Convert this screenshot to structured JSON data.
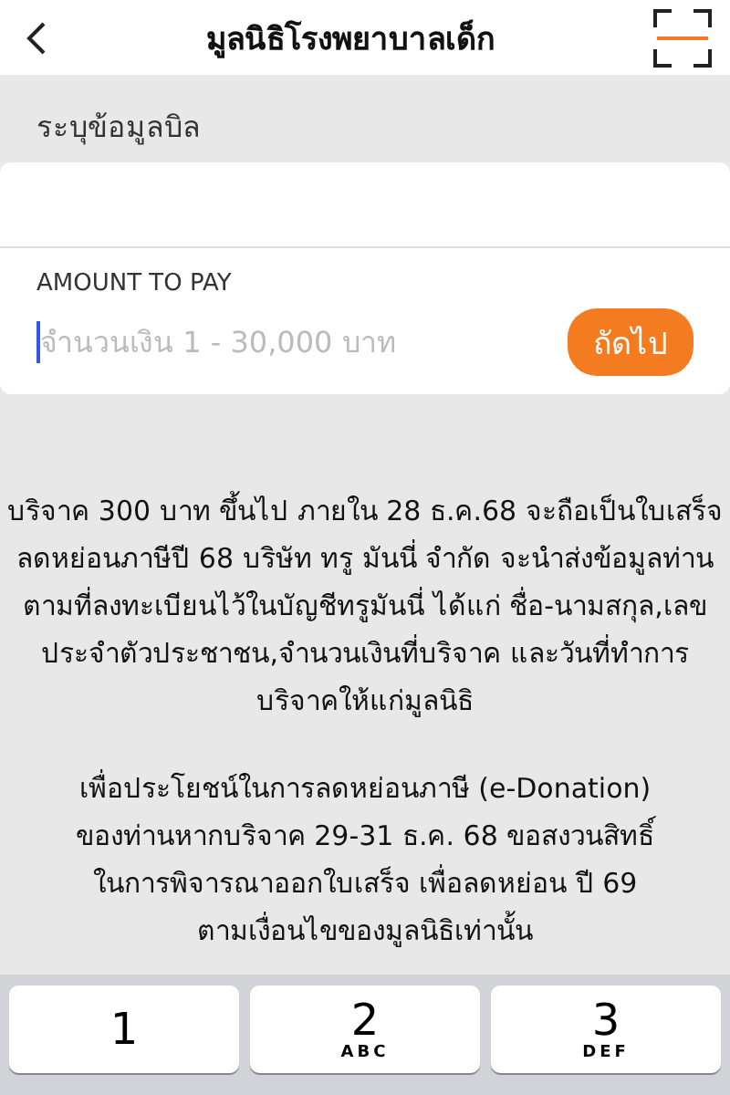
{
  "header": {
    "title": "มูลนิธิโรงพยาบาลเด็ก"
  },
  "section_label": "ระบุข้อมูลบิล",
  "amount": {
    "label": "AMOUNT TO PAY",
    "placeholder": "จำนวนเงิน 1 - 30,000 บาท",
    "button": "ถัดไป"
  },
  "notice": [
    {
      "lines": [
        "บริจาค 300 บาท ขึ้นไป ภายใน 28 ธ.ค.68 จะถือเป็นใบเสร็จ",
        "ลดหย่อนภาษีปี 68 บริษัท ทรู มันนี่ จำกัด จะนำส่งข้อมูลท่าน",
        "ตามที่ลงทะเบียนไว้ในบัญชีทรูมันนี่ ได้แก่ ชื่อ-นามสกุล,เลข",
        "ประจำตัวประชาชน,จำนวนเงินที่บริจาค และวันที่ทำการ",
        "บริจาคให้แก่มูลนิธิ"
      ]
    },
    {
      "lines": [
        "เพื่อประโยชน์ในการลดหย่อนภาษี (e-Donation)",
        "ของท่านหากบริจาค 29-31 ธ.ค. 68 ขอสงวนสิทธิ์",
        "ในการพิจารณาออกใบเสร็จ เพื่อลดหย่อน ปี 69",
        "ตามเงื่อนไขของมูลนิธิเท่านั้น"
      ]
    }
  ],
  "keypad": [
    {
      "digit": "1"
    },
    {
      "digit": "2",
      "letters": "ABC"
    },
    {
      "digit": "3",
      "letters": "DEF"
    }
  ]
}
